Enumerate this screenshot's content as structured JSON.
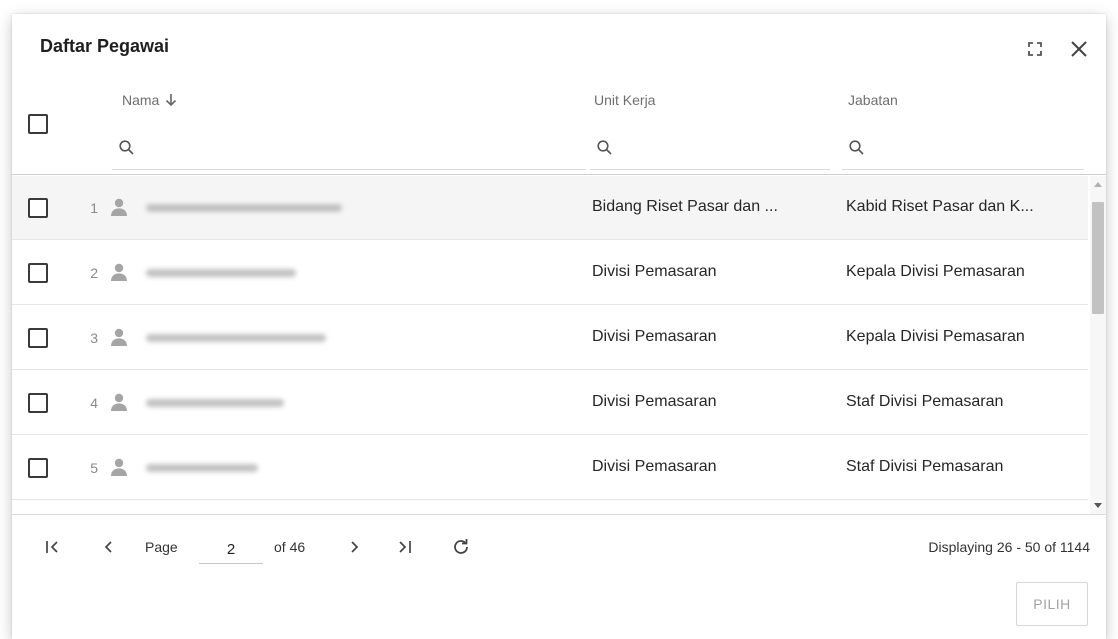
{
  "dialog": {
    "title": "Daftar Pegawai",
    "maximize_icon": "maximize-icon",
    "close_icon": "close-icon"
  },
  "columns": {
    "name": "Nama",
    "name_sort_icon": "arrow-down-icon",
    "unit": "Unit Kerja",
    "jabatan": "Jabatan"
  },
  "rows": [
    {
      "num": "1",
      "unit": "Bidang Riset Pasar dan ...",
      "jabatan": "Kabid Riset Pasar dan K...",
      "selected": true
    },
    {
      "num": "2",
      "unit": "Divisi Pemasaran",
      "jabatan": "Kepala Divisi Pemasaran",
      "selected": false
    },
    {
      "num": "3",
      "unit": "Divisi Pemasaran",
      "jabatan": "Kepala Divisi Pemasaran",
      "selected": false
    },
    {
      "num": "4",
      "unit": "Divisi Pemasaran",
      "jabatan": "Staf Divisi Pemasaran",
      "selected": false
    },
    {
      "num": "5",
      "unit": "Divisi Pemasaran",
      "jabatan": "Staf Divisi Pemasaran",
      "selected": false
    }
  ],
  "pager": {
    "page_label": "Page",
    "page_value": "2",
    "of_label": "of 46",
    "displaying": "Displaying 26 - 50 of 1144"
  },
  "actions": {
    "pilih": "PILIH"
  },
  "colors": {
    "accent_text": "#212121",
    "muted_text": "#6f6f6f",
    "selected_row_bg": "#f5f5f5"
  }
}
